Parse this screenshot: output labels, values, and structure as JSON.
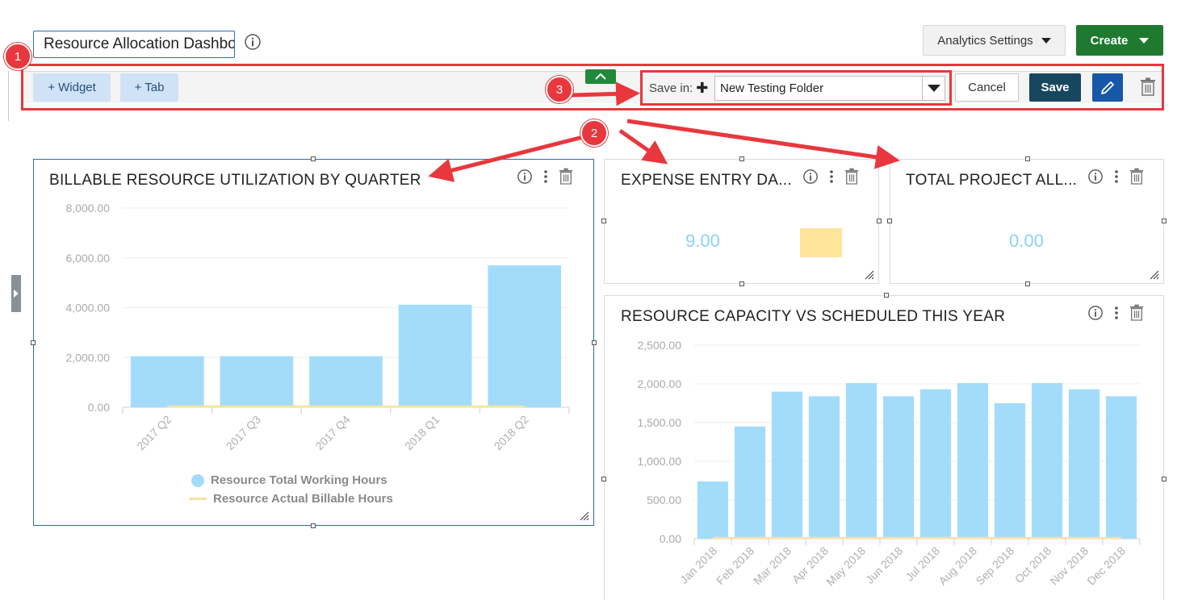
{
  "header": {
    "dashboard_name": "Resource Allocation Dashboard",
    "analytics_settings": "Analytics Settings",
    "create": "Create"
  },
  "toolbar": {
    "add_widget": "+ Widget",
    "add_tab": "+ Tab",
    "save_in_label": "Save in:",
    "folder": "New Testing Folder",
    "cancel": "Cancel",
    "save": "Save"
  },
  "callouts": [
    "1",
    "2",
    "3"
  ],
  "widgets": {
    "billable": {
      "title": "BILLABLE RESOURCE UTILIZATION BY QUARTER",
      "legend": [
        "Resource Total Working Hours",
        "Resource Actual Billable Hours"
      ]
    },
    "expense": {
      "title": "EXPENSE ENTRY DA...",
      "value": "9.00"
    },
    "total_project": {
      "title": "TOTAL PROJECT ALL...",
      "value": "0.00"
    },
    "capacity": {
      "title": "RESOURCE CAPACITY VS SCHEDULED THIS YEAR"
    }
  },
  "colors": {
    "bar": "#a3dcfb",
    "line": "#f6e3a4",
    "accent_red": "#e8373d",
    "create_green": "#1f7a30"
  },
  "chart_data": [
    {
      "type": "bar",
      "title": "BILLABLE RESOURCE UTILIZATION BY QUARTER",
      "categories": [
        "2017 Q2",
        "2017 Q3",
        "2017 Q4",
        "2018 Q1",
        "2018 Q2"
      ],
      "series": [
        {
          "name": "Resource Total Working Hours",
          "values": [
            2050,
            2050,
            2050,
            4120,
            5700
          ]
        },
        {
          "name": "Resource Actual Billable Hours",
          "values": [
            0,
            0,
            0,
            0,
            0
          ]
        }
      ],
      "yticks": [
        "8,000.00",
        "6,000.00",
        "4,000.00",
        "2,000.00",
        "0.00"
      ],
      "ylim": [
        0,
        8000
      ],
      "legend": "bottom"
    },
    {
      "type": "bar",
      "title": "RESOURCE CAPACITY VS SCHEDULED THIS YEAR",
      "categories": [
        "Jan 2018",
        "Feb 2018",
        "Mar 2018",
        "Apr 2018",
        "May 2018",
        "Jun 2018",
        "Jul 2018",
        "Aug 2018",
        "Sep 2018",
        "Oct 2018",
        "Nov 2018",
        "Dec 2018"
      ],
      "series": [
        {
          "values": [
            740,
            1450,
            1900,
            1840,
            2010,
            1840,
            1930,
            2010,
            1750,
            2010,
            1930,
            1840
          ]
        },
        {
          "values": [
            0,
            0,
            0,
            0,
            0,
            0,
            0,
            0,
            0,
            0,
            0,
            0
          ]
        }
      ],
      "yticks": [
        "2,500.00",
        "2,000.00",
        "1,500.00",
        "1,000.00",
        "500.00",
        "0.00"
      ],
      "ylim": [
        0,
        2500
      ]
    }
  ]
}
